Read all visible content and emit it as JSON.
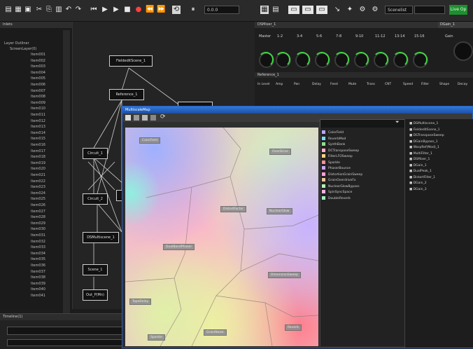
{
  "toolbar": {
    "field1": "0.0.0",
    "field2": "Scenelist",
    "live": "Live Op"
  },
  "tree": {
    "title": "Inlets",
    "root_label": "Layer Outliner",
    "sub_label": "ScreenLayer(0)",
    "items": [
      "Item001",
      "Item002",
      "Item003",
      "Item004",
      "Item005",
      "Item006",
      "Item007",
      "Item008",
      "Item009",
      "Item010",
      "Item011",
      "Item012",
      "Item013",
      "Item014",
      "Item015",
      "Item016",
      "Item017",
      "Item018",
      "Item019",
      "Item020",
      "Item021",
      "Item022",
      "Item023",
      "Item024",
      "Item025",
      "Item026",
      "Item027",
      "Item028",
      "Item029",
      "Item030",
      "Item031",
      "Item032",
      "Item033",
      "Item034",
      "Item035",
      "Item036",
      "Item037",
      "Item038",
      "Item039",
      "Item040",
      "Item041"
    ]
  },
  "graph": {
    "nodes": [
      "FieldeditScene_1",
      "Reference_1",
      "Circuit_1",
      "Circuit_2",
      "Circuit_1b",
      "DSMultiscene_1",
      "Scene_1",
      "Out_P(Mn)"
    ]
  },
  "mixer": {
    "title": "DSMixer_1",
    "title2": "DGain_1",
    "label": "Master",
    "channels": [
      "1-2",
      "3-4",
      "5-6",
      "7-8",
      "9-10",
      "11-12",
      "13-14",
      "15-16"
    ],
    "gain_label": "Gain",
    "reference_title": "Reference_1",
    "columns": [
      "In Level",
      "Amp",
      "Pan",
      "Delay",
      "Feed",
      "Mute",
      "Trans",
      "CNT",
      "Speed",
      "Filter",
      "Shape",
      "Decay"
    ]
  },
  "float_window": {
    "title": "MultiscaleMap",
    "map_labels": [
      "ColorField",
      "OverDrive",
      "DistortFactor",
      "NuclearGlow",
      "DualBandPhaser",
      "DimensionSweep",
      "TapeDelay",
      "GrainNoise",
      "Sparkle",
      "Reverb"
    ],
    "list_items": [
      {
        "label": "ColorField",
        "color": "#b9a6ff"
      },
      {
        "label": "ReverbMod",
        "color": "#7fd8ff"
      },
      {
        "label": "SynthBank",
        "color": "#8ee08e"
      },
      {
        "label": "DCTransposeSweep",
        "color": "#ffb0d0"
      },
      {
        "label": "FilterLFOSweep",
        "color": "#ffd27f"
      },
      {
        "label": "Sparkle",
        "color": "#ff8f8f"
      },
      {
        "label": "PhaserBounce",
        "color": "#c7a6ff"
      },
      {
        "label": "DistortionGrainSweep",
        "color": "#ffa0d8"
      },
      {
        "label": "GrainOverdriveFx",
        "color": "#f0c0a0"
      },
      {
        "label": "NuclearGlowBypass",
        "color": "#b7f0b7"
      },
      {
        "label": "SpinSyncSpace",
        "color": "#ffb0e0"
      },
      {
        "label": "DoubleReverb",
        "color": "#9ff0c0"
      }
    ],
    "right_items": [
      "DSMultiscene_1",
      "FieldeditScene_1",
      "DSTransposeSweep",
      "DGainBypass_1",
      "WarpRef(Mod)_1",
      "MultiFilter_1",
      "DSMixer_1",
      "DGain_1",
      "DualPeak_1",
      "DistortFilter_1",
      "DGain_2",
      "DGain_3"
    ]
  },
  "timeline": {
    "title": "Timeline(1)"
  }
}
